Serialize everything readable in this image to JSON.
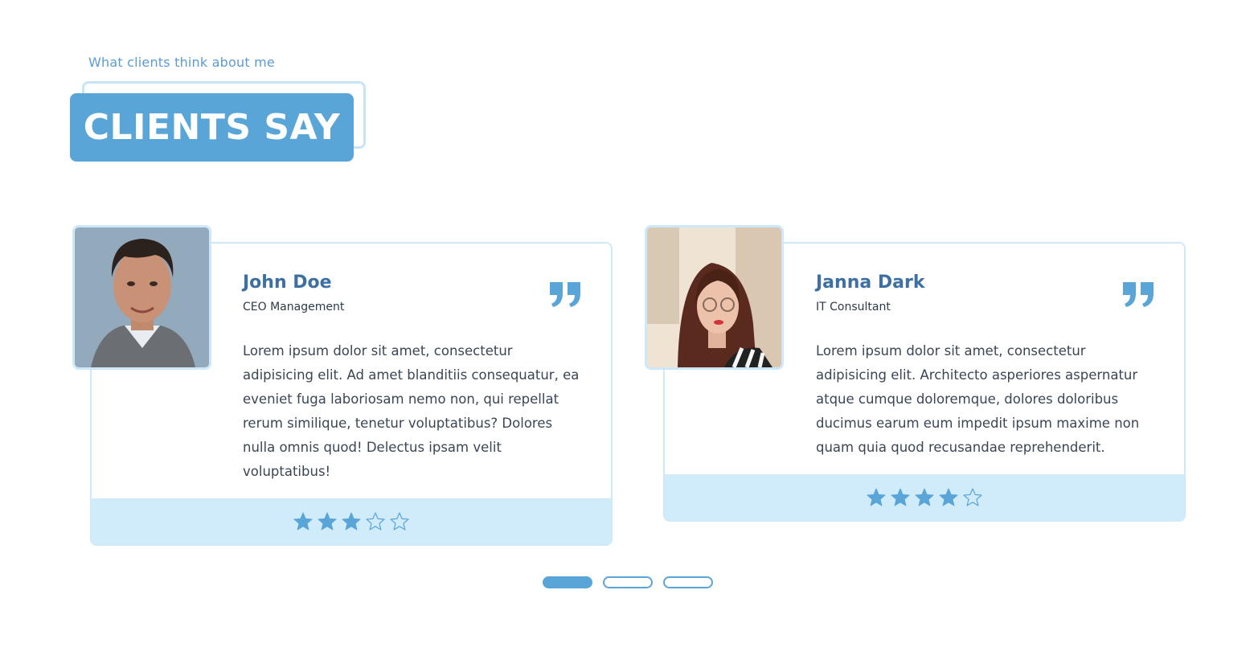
{
  "header": {
    "subtitle": "What clients think about me",
    "title": "CLIENTS SAY"
  },
  "testimonials": [
    {
      "name": "John Doe",
      "role": "CEO Management",
      "text": "Lorem ipsum dolor sit amet, consectetur adipisicing elit. Ad amet blanditiis consequatur, ea eveniet fuga laboriosam nemo non, qui repellat rerum similique, tenetur voluptatibus? Dolores nulla omnis quod! Delectus ipsam velit voluptatibus!",
      "rating": 3,
      "rating_max": 5,
      "avatar_icon": "man-portrait"
    },
    {
      "name": "Janna Dark",
      "role": "IT Consultant",
      "text": "Lorem ipsum dolor sit amet, consectetur adipisicing elit. Architecto asperiores aspernatur atque cumque doloremque, dolores doloribus ducimus earum eum impedit ipsum maxime non quam quia quod recusandae reprehenderit.",
      "rating": 4,
      "rating_max": 5,
      "avatar_icon": "woman-portrait"
    }
  ],
  "pagination": {
    "pages": 3,
    "active_index": 0
  },
  "colors": {
    "accent": "#5aa5d8",
    "name": "#3d6fa3",
    "footer_bg": "#d0ecfb",
    "border": "#cfe9f8"
  }
}
